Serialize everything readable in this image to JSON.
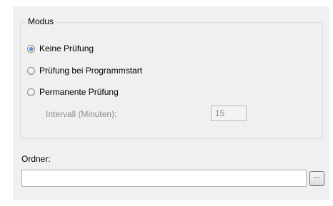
{
  "modus": {
    "title": "Modus",
    "options": [
      {
        "label": "Keine Prüfung",
        "selected": true
      },
      {
        "label": "Prüfung bei Programmstart",
        "selected": false
      },
      {
        "label": "Permanente Prüfung",
        "selected": false
      }
    ],
    "interval": {
      "label": "Intervall (Minuten):",
      "value": "15",
      "enabled": false
    }
  },
  "folder": {
    "label": "Ordner:",
    "value": "",
    "browse_label": "..."
  }
}
